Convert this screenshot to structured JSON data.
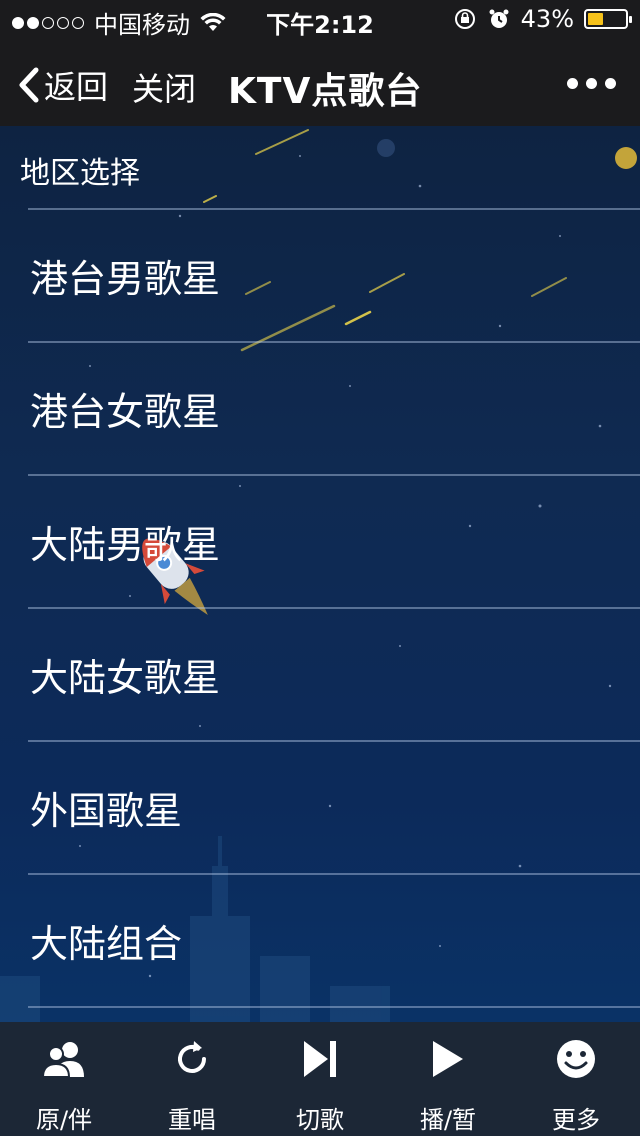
{
  "status": {
    "carrier": "中国移动",
    "time": "下午2:12",
    "battery": "43%",
    "battery_level": 0.43
  },
  "nav": {
    "back_label": "返回",
    "close_label": "关闭",
    "title": "KTV点歌台"
  },
  "section": {
    "title": "地区选择"
  },
  "list": {
    "items": [
      {
        "label": "港台男歌星"
      },
      {
        "label": "港台女歌星"
      },
      {
        "label": "大陆男歌星"
      },
      {
        "label": "大陆女歌星"
      },
      {
        "label": "外国歌星"
      },
      {
        "label": "大陆组合"
      }
    ]
  },
  "toolbar": {
    "items": [
      {
        "label": "原/伴",
        "icon": "users-icon"
      },
      {
        "label": "重唱",
        "icon": "refresh-icon"
      },
      {
        "label": "切歌",
        "icon": "skip-next-icon"
      },
      {
        "label": "播/暂",
        "icon": "play-icon"
      },
      {
        "label": "更多",
        "icon": "smiley-icon"
      }
    ]
  },
  "colors": {
    "bar_bg": "#1b1b1d",
    "bottom_bg": "#1c2736",
    "battery": "#f6c21a"
  }
}
